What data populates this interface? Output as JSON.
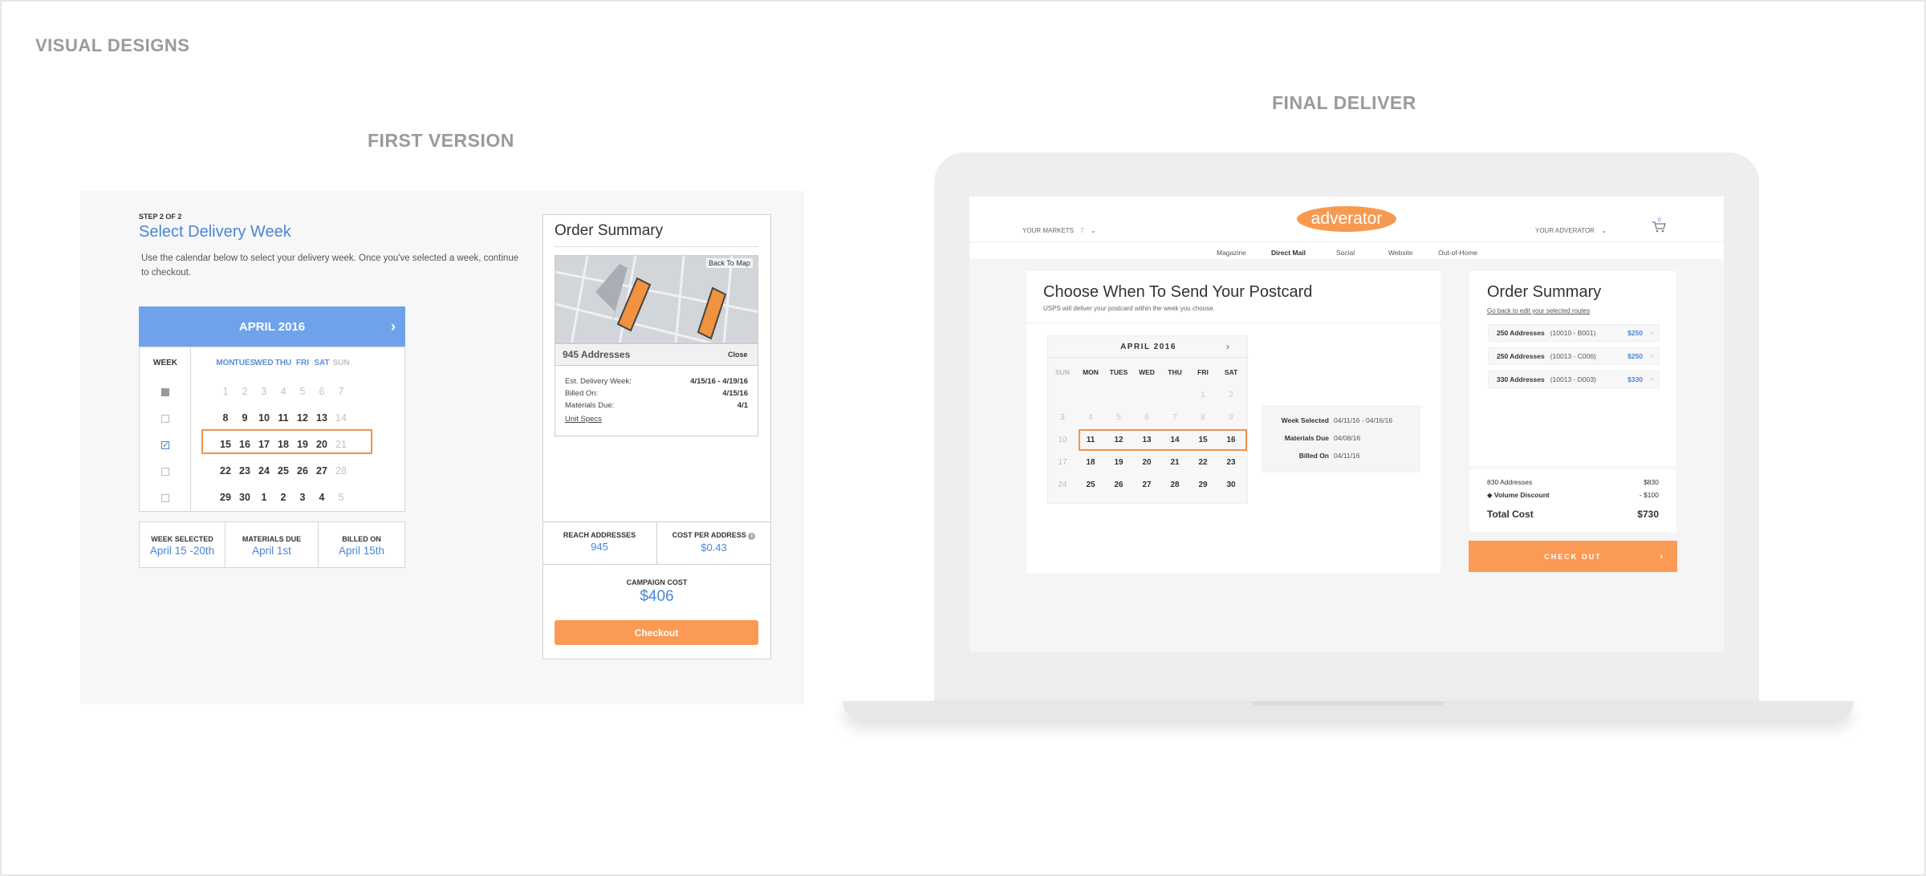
{
  "page_title": "VISUAL DESIGNS",
  "first_version": {
    "heading": "FIRST VERSION",
    "step": "STEP 2 OF 2",
    "title": "Select Delivery Week",
    "desc1": "Use the calendar below to select your delivery week. Once you've selected a week, continue",
    "desc2": "to checkout.",
    "month": "APRIL 2016",
    "next_icon": "chevron-right-icon",
    "week_label": "WEEK",
    "days": [
      "MON",
      "TUES",
      "WED",
      "THU",
      "FRI",
      "SAT",
      "SUN"
    ],
    "rows": [
      {
        "cells": [
          "1",
          "2",
          "3",
          "4",
          "5",
          "6",
          "7"
        ],
        "muted": true
      },
      {
        "cells": [
          "8",
          "9",
          "10",
          "11",
          "12",
          "13",
          "14"
        ]
      },
      {
        "cells": [
          "15",
          "16",
          "17",
          "18",
          "19",
          "20",
          "21"
        ],
        "selected": true
      },
      {
        "cells": [
          "22",
          "23",
          "24",
          "25",
          "26",
          "27",
          "28"
        ]
      },
      {
        "cells": [
          "29",
          "30",
          "1",
          "2",
          "3",
          "4",
          "5"
        ]
      }
    ],
    "stats": [
      {
        "label": "WEEK SELECTED",
        "value": "April 15 -20th"
      },
      {
        "label": "MATERIALS DUE",
        "value": "April 1st"
      },
      {
        "label": "BILLED ON",
        "value": "April 15th"
      }
    ],
    "order_summary": {
      "title": "Order Summary",
      "back_to_map": "Back To Map",
      "addresses": "945 Addresses",
      "close": "Close",
      "details": [
        {
          "k": "Est. Delivery Week:",
          "v": "4/15/16 - 4/19/16"
        },
        {
          "k": "Billed On:",
          "v": "4/15/16"
        },
        {
          "k": "Materials Due:",
          "v": "4/1"
        }
      ],
      "unit_specs": "Unit Specs",
      "reach_label": "REACH ADDRESSES",
      "reach_value": "945",
      "cpa_label": "COST PER ADDRESS",
      "cpa_value": "$0.43",
      "campaign_label": "CAMPAIGN COST",
      "campaign_value": "$406",
      "checkout": "Checkout",
      "accent": "#fa9a55"
    }
  },
  "final": {
    "heading": "FINAL DELIVER",
    "logo": "adverator",
    "your_markets": "YOUR MARKETS",
    "markets_count": "7",
    "your_adverator": "YOUR ADVERATOR",
    "cart_count": "0",
    "nav": [
      "Magazine",
      "Direct Mail",
      "Social",
      "Website",
      "Out-of-Home"
    ],
    "title": "Choose When To Send Your Postcard",
    "subtitle": "USPS will deliver your postcard within the week you choose.",
    "month": "APRIL 2016",
    "days": [
      "SUN",
      "MON",
      "TUES",
      "WED",
      "THU",
      "FRI",
      "SAT"
    ],
    "rows": [
      {
        "cells": [
          "",
          "",
          "",
          "",
          "",
          "1",
          "2"
        ]
      },
      {
        "cells": [
          "3",
          "4",
          "5",
          "6",
          "7",
          "8",
          "9"
        ]
      },
      {
        "cells": [
          "10",
          "11",
          "12",
          "13",
          "14",
          "15",
          "16"
        ],
        "selected": true
      },
      {
        "cells": [
          "17",
          "18",
          "19",
          "20",
          "21",
          "22",
          "23"
        ]
      },
      {
        "cells": [
          "24",
          "25",
          "26",
          "27",
          "28",
          "29",
          "30"
        ]
      }
    ],
    "info": [
      {
        "k": "Week Selected",
        "v": "04/11/16 - 04/16/16"
      },
      {
        "k": "Materials Due",
        "v": "04/08/16"
      },
      {
        "k": "Billed On",
        "v": "04/11/16"
      }
    ],
    "order": {
      "title": "Order Summary",
      "edit_link": "Go back to edit your selected routes",
      "routes": [
        {
          "label": "250 Addresses",
          "code": "(10010 - B001)",
          "price": "$250"
        },
        {
          "label": "250 Addresses",
          "code": "(10013 - C006)",
          "price": "$250"
        },
        {
          "label": "330 Addresses",
          "code": "(10013 - D003)",
          "price": "$330"
        }
      ],
      "subtotal_label": "830 Addresses",
      "subtotal": "$830",
      "discount_label": "Volume Discount",
      "discount": "- $100",
      "total_label": "Total Cost",
      "total": "$730",
      "checkout": "CHECK OUT"
    }
  }
}
